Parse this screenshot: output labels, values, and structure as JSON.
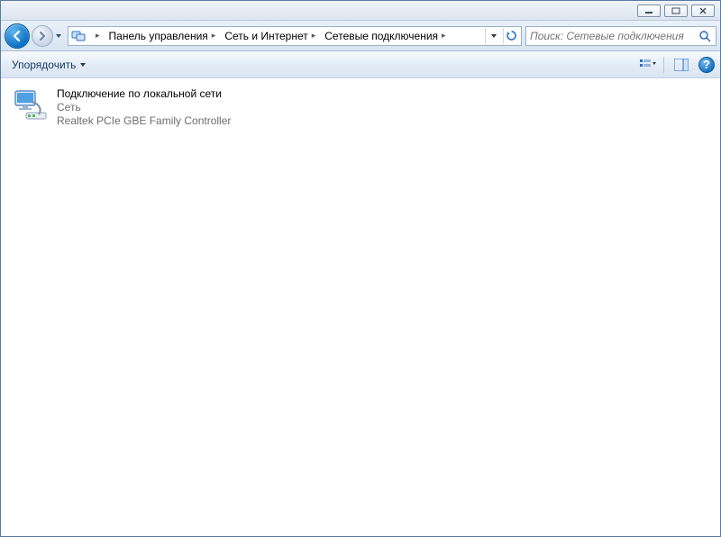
{
  "window": {
    "minimize": "–",
    "maximize": "❐",
    "close": "✕"
  },
  "breadcrumb": {
    "root_sep": "▸",
    "items": [
      {
        "label": "Панель управления"
      },
      {
        "label": "Сеть и Интернет"
      },
      {
        "label": "Сетевые подключения"
      }
    ]
  },
  "search": {
    "placeholder": "Поиск: Сетевые подключения"
  },
  "toolbar": {
    "organize_label": "Упорядочить"
  },
  "connections": [
    {
      "title": "Подключение по локальной сети",
      "status": "Сеть",
      "device": "Realtek PCIe GBE Family Controller"
    }
  ]
}
